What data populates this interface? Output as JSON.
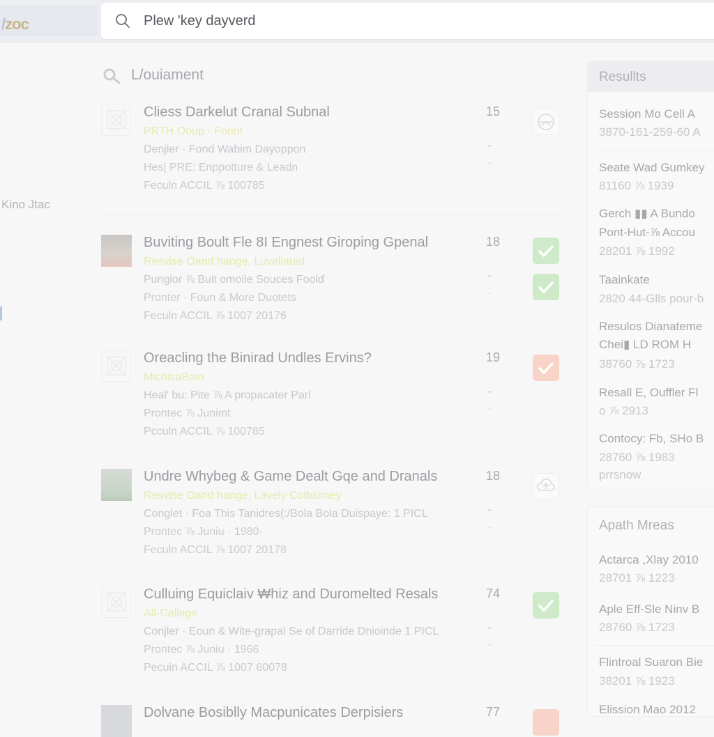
{
  "app": {
    "logo_text": "zoc"
  },
  "search": {
    "value": "Plew 'key dayverd"
  },
  "sidebar": {
    "label": "Kino Jtac"
  },
  "section": {
    "title": "L/ouiament"
  },
  "results": [
    {
      "title": "Cliess Darkelut Cranal Subnal",
      "subtitle": "PRTH Ooup · Forint",
      "line1": "Denjler · Fond Wabim Dayoppon",
      "line2": "Hes| PRE: Enppotture & Leadn",
      "line3": "Feculn ACCIL ⅞ 100785",
      "count": "15",
      "chevron": "⌄",
      "dash": "–",
      "thumb_icon": "placeholder-image-icon",
      "badge_icon": "circle-arrow-icon",
      "badge_state": "outline"
    },
    {
      "title": "Buviting Boult Fle 8I Engnest Giroping Gpenal",
      "subtitle": "Resvise Oand hange, Luvellated",
      "line1": "Punglor ⅞ Bult omoile Souces Foolɗ",
      "line2": "Pronter · Foun & More Duotets",
      "line3": "Feculn ACCIL ⅞ 1007 20176",
      "count": "18",
      "chevron": "⌄",
      "dash": "–",
      "thumb_icon": "photo-thumbnail-icon",
      "badge_icon": "check-icon",
      "badge_state": "green",
      "badge2_icon": "check-icon",
      "badge2_state": "green"
    },
    {
      "title": "Oreacling the Binirad Undles Ervins?",
      "subtitle": "MichisaBoio",
      "line1": "Heal' bu: Pite ⅞ A propacater Parl",
      "line2": "Prontec ⅞ Junimt",
      "line3": "Pcculn ACCIL ⅞ 100785",
      "count": "19",
      "chevron": "⌄",
      "dash": "–",
      "thumb_icon": "placeholder-image-icon",
      "badge_icon": "check-icon",
      "badge_state": "orange"
    },
    {
      "title": "Undre Whybeg & Game Dealt Gqe and Dranals",
      "subtitle": "Resvise Oand hange, Lavely Colbsimey",
      "line1": "Conglet · Foa This Tanidres(:/Bola Bola  Duispaye: 1 PICL",
      "line2": "Prontec ⅞ Juniu · 1980·",
      "line3": "Feculn ACCIL ⅞ 1007 20178",
      "count": "18",
      "chevron": "⌄",
      "dash": "–",
      "thumb_icon": "photo-thumbnail-icon",
      "badge_icon": "cloud-icon",
      "badge_state": "outline"
    },
    {
      "title": "Culluing Equiclaiv ₩hiz and Duromelted Resals",
      "subtitle": "All-Callegs",
      "line1": "Conjler · Eoun & Wite-grapal Se of Darride  Dnioinde  1 PICL",
      "line2": "Prontec ⅞ Juniu · 1966",
      "line3": "Pecuin ACCIL ⅞ 1007 60078",
      "count": "74",
      "chevron": "⌄",
      "dash": "–",
      "thumb_icon": "placeholder-image-icon",
      "badge_icon": "check-icon",
      "badge_state": "green"
    },
    {
      "title": "Dolvane Bosiblly Macpunicates Derpisiers",
      "subtitle": "",
      "line1": "",
      "line2": "",
      "line3": "",
      "count": "77",
      "chevron": "",
      "dash": "",
      "thumb_icon": "photo-thumbnail-icon",
      "badge_icon": "check-icon",
      "badge_state": "orange"
    }
  ],
  "results_panel": {
    "title": "Resullts",
    "items": [
      {
        "line1": "Session Mo Cell A",
        "line2": "3870-161-259-60 A"
      },
      {
        "line1": "Seate Wad Gumkey",
        "line2": "81160 ⅞ 1939"
      },
      {
        "line1": "Gerch ▮▮ A Bundo",
        "line1b": "Pont-Hut-⅞ Accou",
        "line2": "28201 ⅞ 1992"
      },
      {
        "line1": "Taainkate",
        "line2": "2820 44-Glls pour-b"
      },
      {
        "line1": "Resulos Dianateme",
        "line1b": "Chei▮ LD ROM H",
        "line2": "38760 ⅞ 1723"
      },
      {
        "line1": "Resall E, Ouffler Fl",
        "line2": "o ⅞ 2913"
      },
      {
        "line1": "Contocy: Fb, SHo B",
        "line2": "28760 ⅞ 1983",
        "line3": "prrsnow"
      }
    ]
  },
  "areas_panel": {
    "title": "Apath Mreas",
    "items": [
      {
        "line1": "Actarca ,Xlay 2010",
        "line2": "28701 ⅞ 1223"
      },
      {
        "line1": "Aple Eff-Sle Ninv B",
        "line2": "28760 ⅞ 1723"
      },
      {
        "line1": "Flintroal Suaron Bie",
        "line2": "38201 ⅞ 1923"
      },
      {
        "line1": "Elission Mao 2012",
        "line2": ""
      }
    ]
  },
  "colors": {
    "background": "#f7f7f8",
    "green_badge": "#cfeac9",
    "orange_badge": "#f7d4c7",
    "subtitle_yellow": "#e6eab0"
  }
}
